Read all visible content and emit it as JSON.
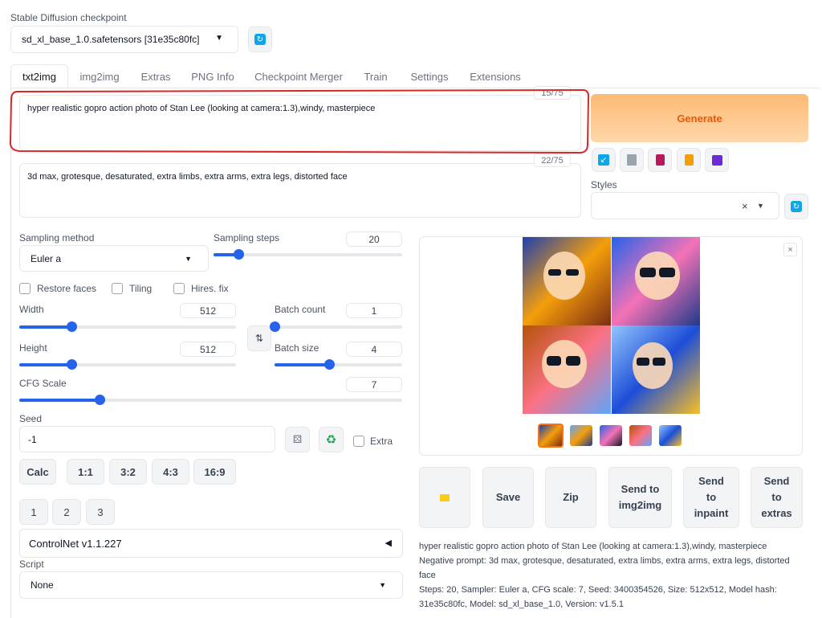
{
  "checkpoint": {
    "label": "Stable Diffusion checkpoint",
    "value": "sd_xl_base_1.0.safetensors [31e35c80fc]"
  },
  "tabs": [
    "txt2img",
    "img2img",
    "Extras",
    "PNG Info",
    "Checkpoint Merger",
    "Train",
    "Settings",
    "Extensions"
  ],
  "prompt": {
    "text": "hyper realistic gopro action photo of Stan Lee (looking at camera:1.3),windy, masterpiece",
    "counter": "15/75"
  },
  "negative_prompt": {
    "text": "3d max, grotesque, desaturated, extra limbs, extra arms, extra legs, distorted face",
    "counter": "22/75"
  },
  "generate_label": "Generate",
  "styles_label": "Styles",
  "sampling": {
    "method_label": "Sampling method",
    "method_value": "Euler a",
    "steps_label": "Sampling steps",
    "steps_value": "20"
  },
  "checks": {
    "restore_faces": "Restore faces",
    "tiling": "Tiling",
    "hires_fix": "Hires. fix"
  },
  "width": {
    "label": "Width",
    "value": "512"
  },
  "height": {
    "label": "Height",
    "value": "512"
  },
  "batch_count": {
    "label": "Batch count",
    "value": "1"
  },
  "batch_size": {
    "label": "Batch size",
    "value": "4"
  },
  "cfg": {
    "label": "CFG Scale",
    "value": "7"
  },
  "seed": {
    "label": "Seed",
    "value": "-1",
    "extra_label": "Extra"
  },
  "ratio_buttons": [
    "Calc",
    "1:1",
    "3:2",
    "4:3",
    "16:9"
  ],
  "page_buttons": [
    "1",
    "2",
    "3"
  ],
  "controlnet_label": "ControlNet v1.1.227",
  "script": {
    "label": "Script",
    "value": "None"
  },
  "output_buttons": {
    "save": "Save",
    "zip": "Zip",
    "send_img2img": [
      "Send to",
      "img2img"
    ],
    "send_inpaint": [
      "Send",
      "to",
      "inpaint"
    ],
    "send_extras": [
      "Send",
      "to",
      "extras"
    ]
  },
  "gen_info": {
    "prompt": "hyper realistic gopro action photo of Stan Lee (looking at camera:1.3),windy, masterpiece",
    "negative": "Negative prompt: 3d max, grotesque, desaturated, extra limbs, extra arms, extra legs, distorted face",
    "params_line1": "Steps: 20, Sampler: Euler a, CFG scale: 7, Seed: 3400354526, Size: 512x512, Model hash:",
    "params_line2": "31e35c80fc, Model: sd_xl_base_1.0, Version: v1.5.1"
  },
  "sliders": {
    "sampling_steps": 0.13,
    "width": 0.24,
    "height": 0.24,
    "batch_count": 0.0,
    "batch_size": 0.43,
    "cfg": 0.21
  },
  "colors": {
    "accent": "#2563eb",
    "generate": "#f97316",
    "annotation": "#dc2626"
  },
  "icons": [
    "refresh-icon",
    "chevron-down-icon",
    "swap-icon",
    "dice-icon",
    "recycle-icon",
    "folder-icon",
    "close-icon",
    "caret-left-icon",
    "arrow-icon",
    "trash-icon",
    "card-icon",
    "clipboard-icon",
    "floppy-icon"
  ]
}
